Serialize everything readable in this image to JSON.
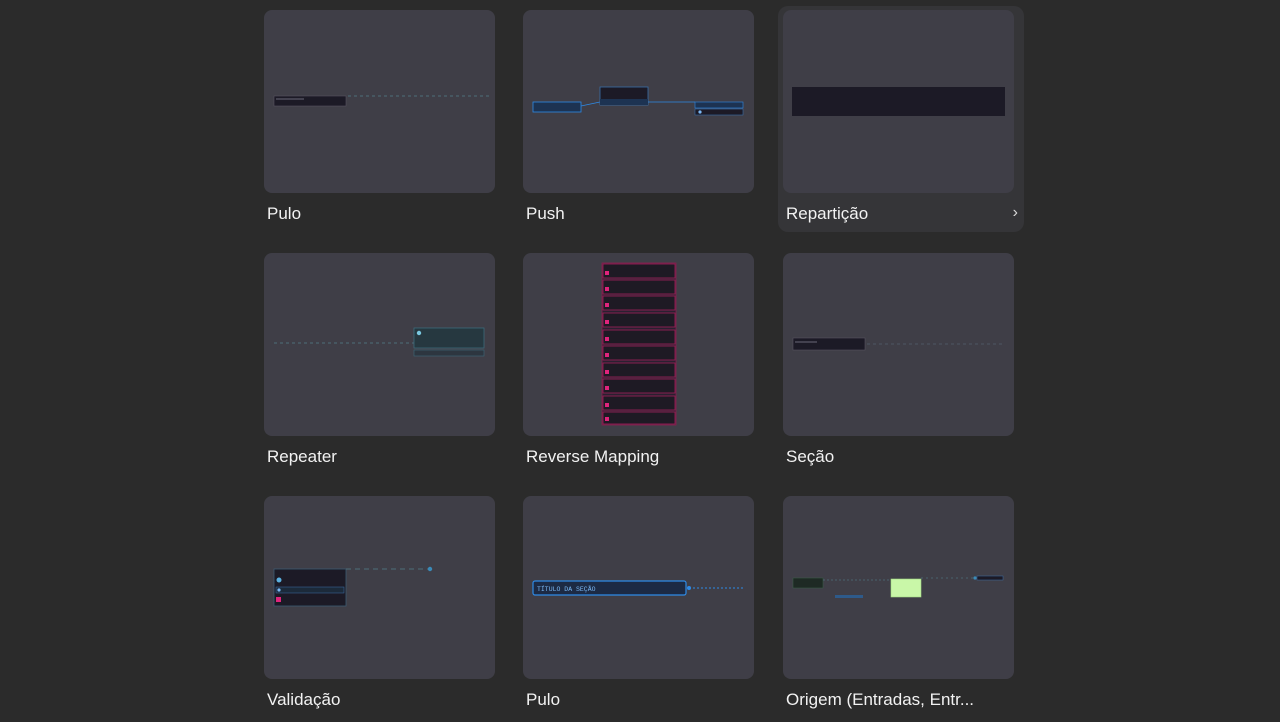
{
  "templates": [
    {
      "label": "Pulo"
    },
    {
      "label": "Push"
    },
    {
      "label": "Repartição"
    },
    {
      "label": "Repeater"
    },
    {
      "label": "Reverse Mapping"
    },
    {
      "label": "Seção"
    },
    {
      "label": "Validação"
    },
    {
      "label": "Pulo"
    },
    {
      "label": "Origem (Entradas, Entr..."
    }
  ],
  "hovered_index": 2,
  "thumb_text": {
    "jump_node": "TÍTULO DA SEÇÃO"
  },
  "colors": {
    "background": "#2b2b2b",
    "card": "#3f3e47",
    "node": "#1c1a26",
    "accent_blue": "#2e8ae6",
    "accent_pink": "#e0247c",
    "accent_green": "#c9f7a8"
  },
  "icons": {
    "chevron": "chevron-right-icon"
  }
}
